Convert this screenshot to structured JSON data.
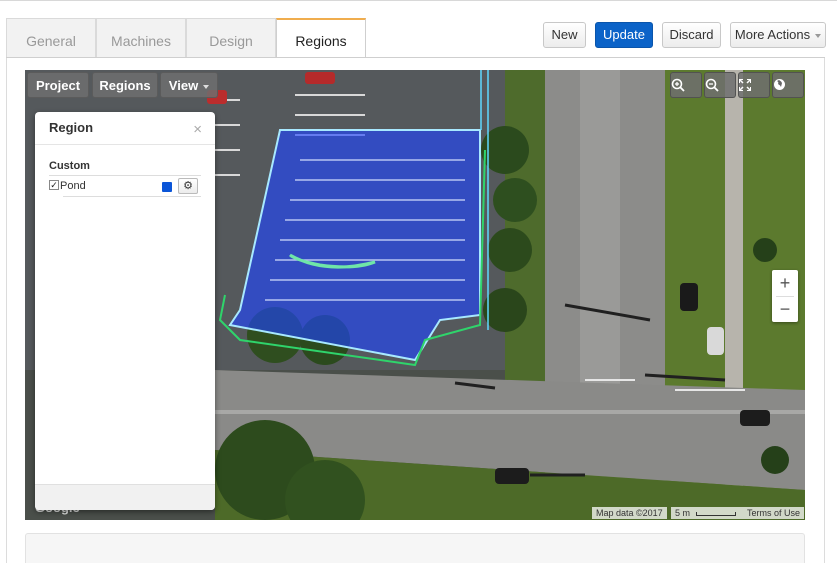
{
  "tabs": [
    {
      "label": "General"
    },
    {
      "label": "Machines"
    },
    {
      "label": "Design"
    },
    {
      "label": "Regions"
    }
  ],
  "active_tab": "Regions",
  "toolbar": {
    "new_label": "New",
    "update_label": "Update",
    "discard_label": "Discard",
    "more_actions_label": "More Actions"
  },
  "map": {
    "controls": {
      "project_label": "Project",
      "regions_label": "Regions",
      "view_label": "View"
    },
    "icons": [
      "zoom-in-icon",
      "zoom-out-icon",
      "fullscreen-icon",
      "globe-icon"
    ],
    "zoom_in": "+",
    "zoom_out": "−",
    "attribution": {
      "map_data": "Map data ©2017",
      "scale": "5 m",
      "terms": "Terms of Use"
    },
    "logo_text": "Google"
  },
  "region_panel": {
    "title": "Region",
    "close": "×",
    "section": "Custom",
    "items": [
      {
        "name": "Pond",
        "checked": true,
        "color": "#0b55d8"
      }
    ]
  },
  "colors": {
    "accent": "#0b63c8",
    "region_fill": "#1f44ff",
    "active_tab_border": "#f0ad4e"
  }
}
